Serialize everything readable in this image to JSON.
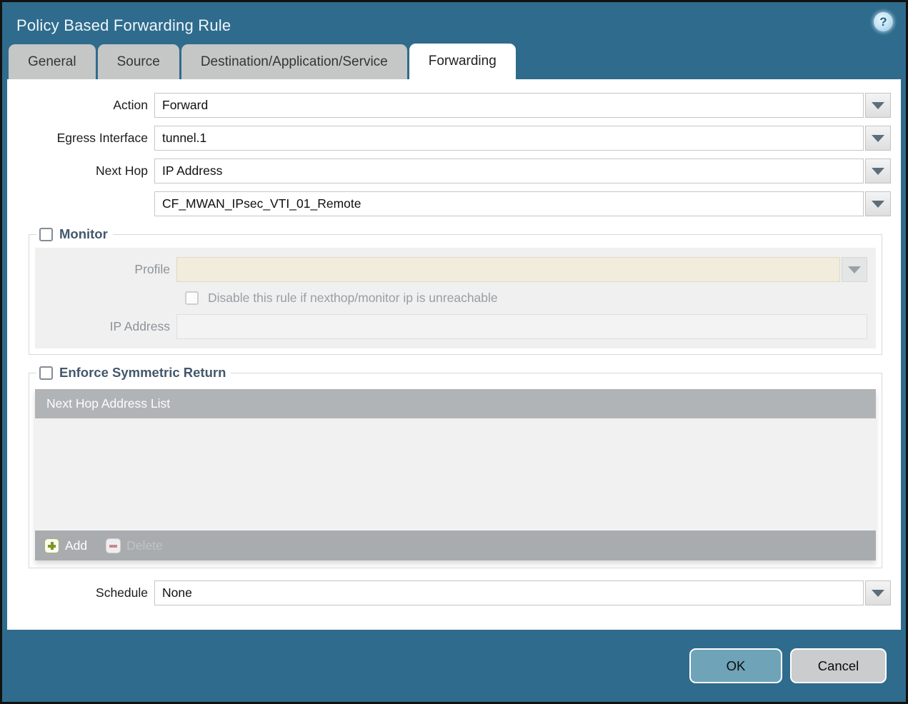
{
  "dialog": {
    "title": "Policy Based Forwarding Rule",
    "help_glyph": "?"
  },
  "tabs": {
    "items": [
      {
        "label": "General",
        "active": false
      },
      {
        "label": "Source",
        "active": false
      },
      {
        "label": "Destination/Application/Service",
        "active": false
      },
      {
        "label": "Forwarding",
        "active": true
      }
    ]
  },
  "form": {
    "action": {
      "label": "Action",
      "value": "Forward"
    },
    "egress_interface": {
      "label": "Egress Interface",
      "value": "tunnel.1"
    },
    "next_hop": {
      "label": "Next Hop",
      "value": "IP Address"
    },
    "next_hop_address": {
      "value": "CF_MWAN_IPsec_VTI_01_Remote"
    },
    "schedule": {
      "label": "Schedule",
      "value": "None"
    }
  },
  "monitor": {
    "legend": "Monitor",
    "checked": false,
    "profile": {
      "label": "Profile",
      "value": ""
    },
    "disable_rule": {
      "label": "Disable this rule if nexthop/monitor ip is unreachable",
      "checked": false
    },
    "ip_address": {
      "label": "IP Address",
      "value": ""
    }
  },
  "enforce_symmetric_return": {
    "legend": "Enforce Symmetric Return",
    "checked": false,
    "table": {
      "header": "Next Hop Address List",
      "rows": []
    },
    "add_label": "Add",
    "delete_label": "Delete"
  },
  "footer": {
    "ok_label": "OK",
    "cancel_label": "Cancel"
  },
  "colors": {
    "titlebar_teal": "#2f6b8c",
    "ok_button": "#6fa3b8",
    "cancel_button": "#caccce",
    "tab_inactive": "#c5c6c6",
    "disabled_required_field": "#f2ecdc",
    "panel_gray": "#f0f0f0",
    "table_header": "#b1b4b6",
    "table_footer": "#a9acae",
    "legend_text": "#44586c"
  }
}
